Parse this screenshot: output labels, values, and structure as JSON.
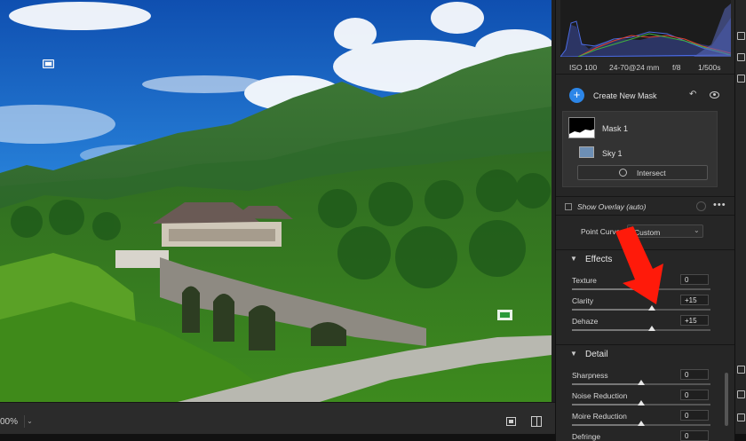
{
  "canvas": {
    "zoom": "00%",
    "scene": "photograph: stone arch bridge leading to a pagoda-roofed hilltop building, forested green mountains under a blue sky with white clouds"
  },
  "exif": {
    "iso": "ISO 100",
    "lens": "24-70@24 mm",
    "aperture": "f/8",
    "shutter": "1/500s"
  },
  "masks": {
    "create_label": "Create New Mask",
    "items": [
      {
        "label": "Mask 1"
      },
      {
        "label": "Sky 1"
      }
    ],
    "intersect_label": "Intersect"
  },
  "overlay": {
    "label": "Show Overlay (auto)"
  },
  "point_curve": {
    "label": "Point Curve",
    "value": "Custom"
  },
  "effects": {
    "title": "Effects",
    "sliders": [
      {
        "label": "Texture",
        "value": "0",
        "level": 0.5
      },
      {
        "label": "Clarity",
        "value": "+15",
        "level": 0.575
      },
      {
        "label": "Dehaze",
        "value": "+15",
        "level": 0.575
      }
    ]
  },
  "detail": {
    "title": "Detail",
    "sliders": [
      {
        "label": "Sharpness",
        "value": "0",
        "level": 0.5
      },
      {
        "label": "Noise Reduction",
        "value": "0",
        "level": 0.5
      },
      {
        "label": "Moire Reduction",
        "value": "0",
        "level": 0.5
      },
      {
        "label": "Defringe",
        "value": "0",
        "level": 0.5
      }
    ]
  },
  "annotation": {
    "arrow_color": "#ff1a0a"
  },
  "colors": {
    "accent": "#2c86e8",
    "panel": "#262626"
  }
}
